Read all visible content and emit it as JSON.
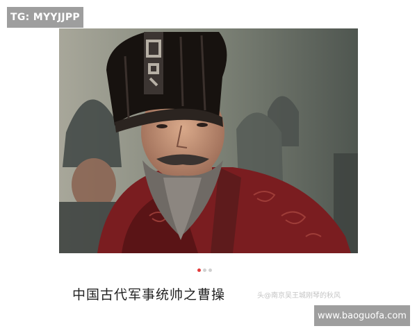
{
  "overlays": {
    "tg_label": "TG: MYYJJPP",
    "site_label": "www.baoguofa.com"
  },
  "carousel": {
    "caption": "中国古代军事统帅之曹操",
    "source_watermark": "头@南京吴王城刚琴的秋风",
    "page_count": 3,
    "active_page": 1,
    "active_color": "#e33b3b",
    "inactive_color": "#d0d0d0"
  }
}
